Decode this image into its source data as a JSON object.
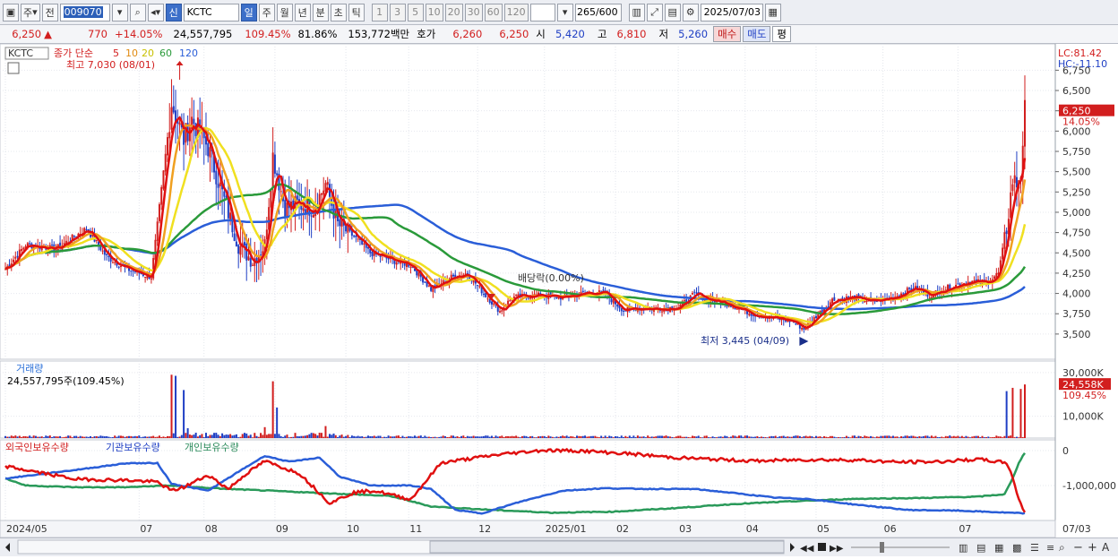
{
  "toolbar": {
    "market_toggle": "주",
    "prev_label": "전",
    "code": "009070",
    "badge_new": "신",
    "stock_name": "KCTC",
    "periods": [
      "일",
      "주",
      "월",
      "년",
      "분",
      "초",
      "틱"
    ],
    "intervals": [
      "1",
      "3",
      "5",
      "10",
      "20",
      "30",
      "60",
      "120"
    ],
    "count": "265",
    "count_max": "/600",
    "date": "2025/07/03"
  },
  "quote": {
    "price": "6,250",
    "arrow": "▲",
    "change": "770",
    "change_pct": "+14.05%",
    "volume": "24,557,795",
    "volume_ratio": "109.45%",
    "turnover_ratio": "81.86%",
    "amount": "153,772백만",
    "hoga_label": "호가",
    "ask": "6,260",
    "bid": "6,250",
    "open_label": "시",
    "open": "5,420",
    "high_label": "고",
    "high": "6,810",
    "low_label": "저",
    "low": "5,260",
    "buy_label": "매수",
    "sell_label": "매도",
    "eval_label": "평"
  },
  "price_panel": {
    "stock_tag": "KCTC",
    "legend_prefix": "종가 단순",
    "ma_labels": [
      "5",
      "10",
      "20",
      "60",
      "120"
    ],
    "high_note": "최고 7,030 (08/01)",
    "low_note": "최저 3,445 (04/09)",
    "dividend_note": "배당락(0.00%)",
    "lc": "LC:81.42",
    "hc": "HC:-11.10",
    "current_tag": "6,250",
    "current_pct": "14.05%"
  },
  "volume_panel": {
    "title": "거래량",
    "value": "24,557,795주(109.45%)",
    "current_tag": "24,558K",
    "current_pct": "109.45%"
  },
  "holdings_panel": {
    "series_labels": [
      "외국인보유수량",
      "기관보유수량",
      "개인보유수량"
    ]
  },
  "x_labels": [
    "2024/05",
    "07",
    "08",
    "09",
    "10",
    "11",
    "12",
    "2025/01",
    "02",
    "03",
    "04",
    "05",
    "06",
    "07",
    "07/03"
  ],
  "colors": {
    "up": "#d21e1e",
    "down": "#1f3fc4",
    "ma5": "#e01010",
    "ma10": "#f0a020",
    "ma20": "#f0e020",
    "ma60": "#2a9a3a",
    "ma120": "#2a5ed8",
    "foreign": "#e01010",
    "institution": "#2a5ed8",
    "individual": "#2a9a5a"
  },
  "chart_data": [
    {
      "type": "candlestick",
      "ylim": [
        3300,
        7030
      ],
      "y_ticks": [
        "6,750",
        "6,500",
        "6,250",
        "6,000",
        "5,750",
        "5,500",
        "5,250",
        "5,000",
        "4,750",
        "4,500",
        "4,250",
        "4,000",
        "3,750",
        "3,500"
      ],
      "close_anchors": [
        [
          0,
          4300
        ],
        [
          10,
          4600
        ],
        [
          25,
          4550
        ],
        [
          40,
          4800
        ],
        [
          50,
          4450
        ],
        [
          60,
          4300
        ],
        [
          72,
          4200
        ],
        [
          82,
          6350
        ],
        [
          88,
          5900
        ],
        [
          92,
          6150
        ],
        [
          100,
          5800
        ],
        [
          108,
          5150
        ],
        [
          115,
          4600
        ],
        [
          122,
          4400
        ],
        [
          128,
          4600
        ],
        [
          132,
          5700
        ],
        [
          138,
          5050
        ],
        [
          145,
          5100
        ],
        [
          152,
          5050
        ],
        [
          158,
          5350
        ],
        [
          164,
          4850
        ],
        [
          172,
          4700
        ],
        [
          180,
          4500
        ],
        [
          192,
          4400
        ],
        [
          200,
          4350
        ],
        [
          210,
          4050
        ],
        [
          220,
          4200
        ],
        [
          228,
          4250
        ],
        [
          236,
          4000
        ],
        [
          244,
          3780
        ],
        [
          250,
          3950
        ],
        [
          262,
          3980
        ],
        [
          275,
          3950
        ],
        [
          285,
          4000
        ],
        [
          295,
          4010
        ],
        [
          305,
          3790
        ],
        [
          312,
          3820
        ],
        [
          322,
          3810
        ],
        [
          332,
          3830
        ],
        [
          340,
          3990
        ],
        [
          348,
          3920
        ],
        [
          358,
          3860
        ],
        [
          368,
          3750
        ],
        [
          378,
          3700
        ],
        [
          388,
          3660
        ],
        [
          394,
          3560
        ],
        [
          400,
          3720
        ],
        [
          408,
          3920
        ],
        [
          418,
          3950
        ],
        [
          428,
          3900
        ],
        [
          438,
          3950
        ],
        [
          448,
          4070
        ],
        [
          456,
          3980
        ],
        [
          466,
          4080
        ],
        [
          476,
          4150
        ],
        [
          484,
          4130
        ],
        [
          490,
          4250
        ],
        [
          494,
          4800
        ],
        [
          497,
          5400
        ],
        [
          499,
          5350
        ],
        [
          501,
          5500
        ],
        [
          503,
          6250
        ]
      ],
      "note": "ma5/ma10/ma20/ma60/ma120 moving averages over the close series"
    },
    {
      "type": "bar",
      "name": "거래량",
      "ylim": [
        0,
        32000
      ],
      "y_ticks": [
        "30,000K",
        "10,000K"
      ],
      "spikes": [
        [
          82,
          29000
        ],
        [
          84,
          28500
        ],
        [
          88,
          22000
        ],
        [
          90,
          4500
        ],
        [
          132,
          26000
        ],
        [
          134,
          14000
        ],
        [
          128,
          5000
        ],
        [
          158,
          5500
        ],
        [
          494,
          21500
        ],
        [
          497,
          23000
        ],
        [
          501,
          22500
        ],
        [
          503,
          24558
        ]
      ]
    },
    {
      "type": "line",
      "series": [
        {
          "name": "외국인보유수량",
          "anchors": [
            [
              0,
              -450000
            ],
            [
              35,
              -820000
            ],
            [
              60,
              -850000
            ],
            [
              75,
              -900000
            ],
            [
              82,
              -1150000
            ],
            [
              88,
              -1050000
            ],
            [
              100,
              -700000
            ],
            [
              110,
              -1100000
            ],
            [
              118,
              -700000
            ],
            [
              128,
              -300000
            ],
            [
              135,
              -450000
            ],
            [
              145,
              -650000
            ],
            [
              160,
              -1500000
            ],
            [
              172,
              -1200000
            ],
            [
              182,
              -1150000
            ],
            [
              200,
              -1400000
            ],
            [
              215,
              -350000
            ],
            [
              245,
              -100000
            ],
            [
              265,
              10000
            ],
            [
              285,
              -10000
            ],
            [
              310,
              -100000
            ],
            [
              330,
              -200000
            ],
            [
              350,
              -250000
            ],
            [
              370,
              -300000
            ],
            [
              395,
              -260000
            ],
            [
              420,
              -270000
            ],
            [
              440,
              -330000
            ],
            [
              460,
              -320000
            ],
            [
              480,
              -250000
            ],
            [
              494,
              -350000
            ],
            [
              497,
              -750000
            ],
            [
              499,
              -1200000
            ],
            [
              501,
              -1550000
            ],
            [
              503,
              -1750000
            ]
          ]
        },
        {
          "name": "기관보유수량",
          "anchors": [
            [
              0,
              -800000
            ],
            [
              35,
              -550000
            ],
            [
              60,
              -360000
            ],
            [
              75,
              -360000
            ],
            [
              82,
              -950000
            ],
            [
              100,
              -1150000
            ],
            [
              118,
              -500000
            ],
            [
              128,
              -150000
            ],
            [
              140,
              -320000
            ],
            [
              155,
              -200000
            ],
            [
              165,
              -750000
            ],
            [
              180,
              -1000000
            ],
            [
              200,
              -1000000
            ],
            [
              210,
              -1100000
            ],
            [
              222,
              -1700000
            ],
            [
              235,
              -1800000
            ],
            [
              255,
              -1450000
            ],
            [
              275,
              -1150000
            ],
            [
              295,
              -1080000
            ],
            [
              320,
              -1100000
            ],
            [
              340,
              -1100000
            ],
            [
              360,
              -1220000
            ],
            [
              380,
              -1350000
            ],
            [
              395,
              -1380000
            ],
            [
              420,
              -1550000
            ],
            [
              445,
              -1700000
            ],
            [
              470,
              -1720000
            ],
            [
              495,
              -1780000
            ],
            [
              503,
              -1800000
            ]
          ]
        },
        {
          "name": "개인보유수량",
          "anchors": [
            [
              0,
              -800000
            ],
            [
              10,
              -1000000
            ],
            [
              35,
              -1050000
            ],
            [
              60,
              -1050000
            ],
            [
              80,
              -1000000
            ],
            [
              95,
              -1050000
            ],
            [
              110,
              -1100000
            ],
            [
              130,
              -1150000
            ],
            [
              150,
              -1200000
            ],
            [
              170,
              -1250000
            ],
            [
              190,
              -1300000
            ],
            [
              210,
              -1600000
            ],
            [
              240,
              -1700000
            ],
            [
              270,
              -1780000
            ],
            [
              300,
              -1750000
            ],
            [
              330,
              -1650000
            ],
            [
              360,
              -1530000
            ],
            [
              390,
              -1450000
            ],
            [
              420,
              -1380000
            ],
            [
              450,
              -1360000
            ],
            [
              480,
              -1320000
            ],
            [
              493,
              -1250000
            ],
            [
              497,
              -800000
            ],
            [
              500,
              -350000
            ],
            [
              503,
              -60000
            ]
          ]
        }
      ],
      "y_ticks": [
        "0",
        "-1,000,000"
      ]
    }
  ]
}
